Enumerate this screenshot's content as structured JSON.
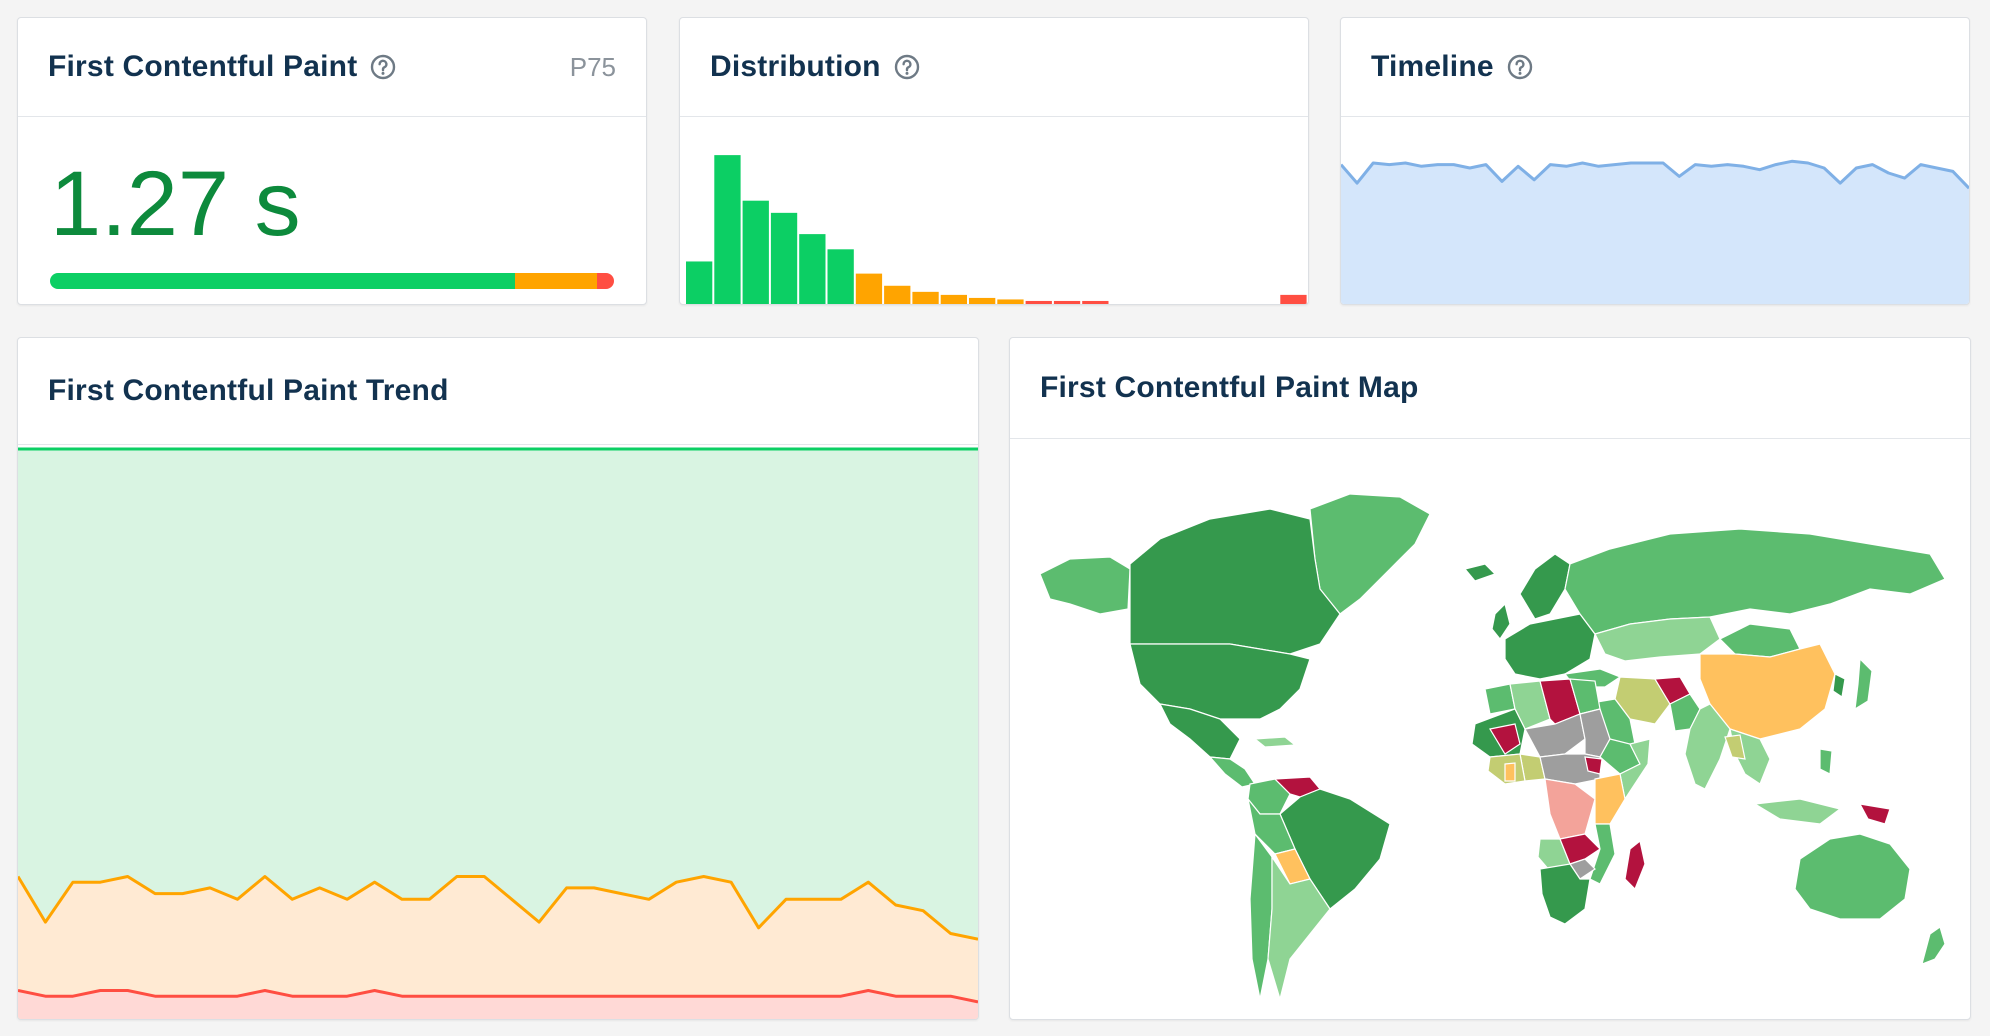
{
  "colors": {
    "good": "#0ccf64",
    "needs_improvement": "#ffa400",
    "poor": "#ff4e42",
    "value_text": "#0d8a3c",
    "title_text": "#12324f",
    "timeline_line": "#7fb0e6",
    "timeline_fill": "#d4e6fb"
  },
  "metric_card": {
    "title": "First Contentful Paint",
    "help_icon": "question-circle-icon",
    "percentile": "P75",
    "value": "1.27 s",
    "split_percent": {
      "good": 82.5,
      "needs_improvement": 14.5,
      "poor": 3.0
    }
  },
  "distribution_card": {
    "title": "Distribution",
    "help_icon": "question-circle-icon"
  },
  "timeline_card": {
    "title": "Timeline",
    "help_icon": "question-circle-icon"
  },
  "trend_card": {
    "title": "First Contentful Paint Trend"
  },
  "map_card": {
    "title": "First Contentful Paint Map",
    "map_icon": "world-map-icon"
  },
  "chart_data": [
    {
      "id": "distribution",
      "type": "bar",
      "bins": 22,
      "values": [
        14,
        49,
        34,
        30,
        23,
        18,
        10,
        6,
        4,
        3,
        2,
        1.5,
        1,
        1,
        1,
        0,
        0,
        0,
        0,
        0,
        0,
        3
      ],
      "classes": [
        "good",
        "good",
        "good",
        "good",
        "good",
        "good",
        "needs_improvement",
        "needs_improvement",
        "needs_improvement",
        "needs_improvement",
        "needs_improvement",
        "needs_improvement",
        "poor",
        "poor",
        "poor",
        "poor",
        "poor",
        "poor",
        "poor",
        "poor",
        "poor",
        "poor"
      ],
      "ylim": [
        0,
        52
      ]
    },
    {
      "id": "timeline",
      "type": "area",
      "values": [
        77,
        66,
        78,
        77,
        78,
        76,
        77,
        77,
        75,
        77,
        67,
        76,
        68,
        77,
        76,
        78,
        76,
        77,
        78,
        78,
        78,
        70,
        77,
        76,
        77,
        76,
        74,
        77,
        79,
        78,
        75,
        66,
        75,
        77,
        72,
        69,
        77,
        75,
        73,
        63
      ],
      "ylim": [
        0,
        100
      ]
    },
    {
      "id": "trend",
      "type": "area",
      "stacked_percent": true,
      "series": [
        {
          "name": "",
          "class": "good",
          "values": []
        },
        {
          "name": "",
          "class": "needs_improvement",
          "values": [
            20,
            13,
            20,
            19,
            20,
            18,
            18,
            19,
            17,
            20,
            17,
            19,
            17,
            19,
            17,
            17,
            21,
            21,
            17,
            13,
            19,
            19,
            18,
            17,
            20,
            21,
            20,
            12,
            17,
            17,
            17,
            19,
            16,
            15,
            11,
            11
          ]
        },
        {
          "name": "",
          "class": "poor",
          "values": [
            5,
            4,
            4,
            5,
            5,
            4,
            4,
            4,
            4,
            5,
            4,
            4,
            4,
            5,
            4,
            4,
            4,
            4,
            4,
            4,
            4,
            4,
            4,
            4,
            4,
            4,
            4,
            4,
            4,
            4,
            4,
            5,
            4,
            4,
            4,
            3
          ]
        }
      ],
      "ylim": [
        0,
        100
      ]
    }
  ]
}
